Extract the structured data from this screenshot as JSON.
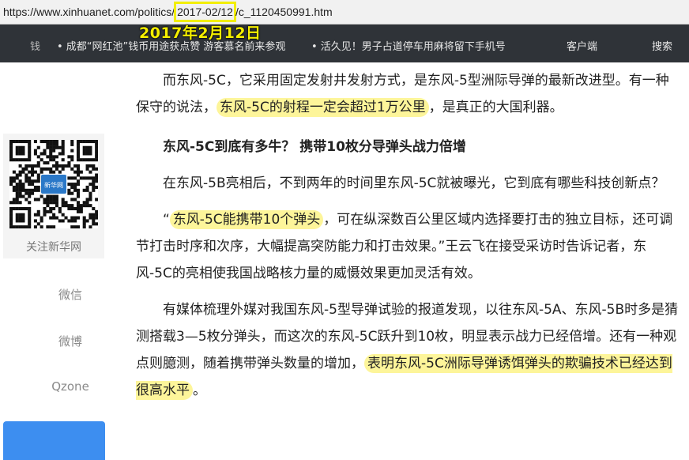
{
  "browser": {
    "url_prefix": "https://www.xinhuanet.com/politics/",
    "url_date": "2017-02/12",
    "url_suffix": "/c_1120450991.htm"
  },
  "annotation": "2017年2月12日",
  "nav": {
    "ticker_fragment": "钱",
    "ticker_1": "• 成都“网红池”钱币用途获点赞 游客慕名前来参观",
    "ticker_2": "• 活久见！男子占道停车用麻将留下手机号",
    "client": "客户端",
    "search": "搜索"
  },
  "sidebar": {
    "qr_label": "关注新华网",
    "qr_logo": "新华网",
    "links": [
      "微信",
      "微博",
      "Qzone"
    ]
  },
  "article": {
    "p1_a": "而东风-5C，它采用固定发射井发射方式，是东风-5型洲际导弹的最新改进型。有一种保守的说法，",
    "p1_hl": "东风-5C的射程一定会超过1万公里",
    "p1_b": "，是真正的大国利器。",
    "subtitle": "东风-5C到底有多牛？ 携带10枚分导弹头战力倍增",
    "p2": "在东风-5B亮相后，不到两年的时间里东风-5C就被曝光，它到底有哪些科技创新点？",
    "p3_a": "“",
    "p3_hl": "东风-5C能携带10个弹头",
    "p3_b": "，可在纵深数百公里区域内选择要打击的独立目标，还可调节打击时序和次序，大幅提高突防能力和打击效果。”王云飞在接受采访时告诉记者，东风-5C的亮相使我国战略核力量的威慑效果更加灵活有效。",
    "p4_a": "有媒体梳理外媒对我国东风-5型导弹试验的报道发现，以往东风-5A、东风-5B时多是猜测搭载3—5枚分弹头，而这次的东风-5C跃升到10枚，明显表示战力已经倍增。还有一种观点则臆测，随着携带弹头数量的增加，",
    "p4_hl": "表明东风-5C洲际导弹诱饵弹头的欺骗技术已经达到很高水平",
    "p4_b": "。"
  },
  "colors": {
    "highlight": "#fdf59a",
    "annotation": "#f5ef00",
    "navbar": "#2f3338",
    "button": "#3d8ef0"
  }
}
